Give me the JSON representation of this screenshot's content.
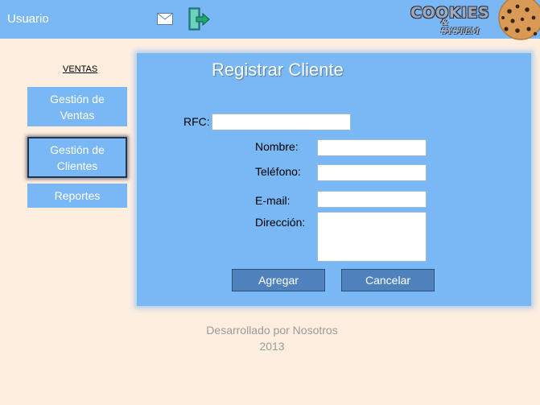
{
  "header": {
    "user_label": "Usuario",
    "logo_main": "COOKIES",
    "logo_sub": "& SYSTEM"
  },
  "sidebar": {
    "section_title": "VENTAS",
    "items": [
      {
        "label": "Gestión de Ventas"
      },
      {
        "label": "Gestión de Clientes"
      },
      {
        "label": "Reportes"
      }
    ]
  },
  "form": {
    "title": "Registrar Cliente",
    "rfc_label": "RFC:",
    "nombre_label": "Nombre:",
    "telefono_label": "Teléfono:",
    "email_label": "E-mail:",
    "direccion_label": "Dirección:",
    "rfc_value": "",
    "nombre_value": "",
    "telefono_value": "",
    "email_value": "",
    "direccion_value": "",
    "agregar_label": "Agregar",
    "cancelar_label": "Cancelar"
  },
  "footer": {
    "line1": "Desarrollado por Nosotros",
    "line2": "2013"
  },
  "colors": {
    "header_bg": "#7ab8f5",
    "page_bg": "#fdeee0",
    "button_bg": "#4f81bd"
  },
  "icons": {
    "mail": "mail-icon",
    "exit": "exit-icon",
    "logo": "cookie-icon"
  }
}
